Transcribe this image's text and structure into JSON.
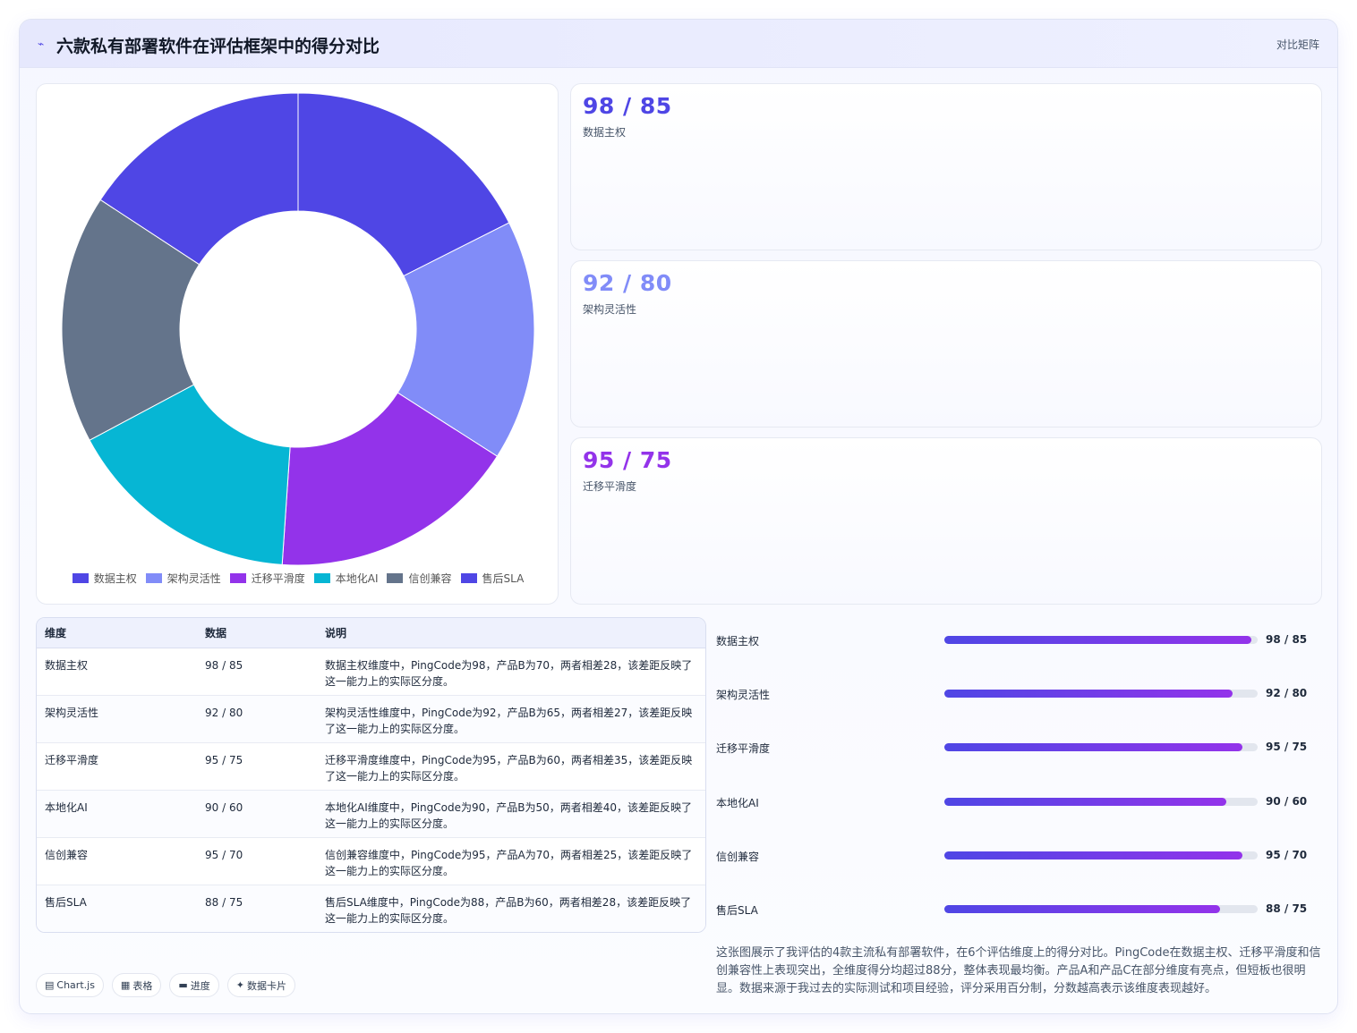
{
  "header": {
    "icon": "chart-line-icon",
    "title": "六款私有部署软件在评估框架中的得分对比",
    "tag": "对比矩阵"
  },
  "colors": {
    "indigo": "#4f46e5",
    "periwinkle": "#818cf8",
    "purple": "#9333ea",
    "cyan": "#06b6d4",
    "slate": "#64748b"
  },
  "chart_data": {
    "type": "pie",
    "categories": [
      "数据主权",
      "架构灵活性",
      "迁移平滑度",
      "本地化AI",
      "信创兼容",
      "售后SLA"
    ],
    "values": [
      98,
      92,
      95,
      90,
      95,
      88
    ],
    "colors": [
      "#4f46e5",
      "#818cf8",
      "#9333ea",
      "#06b6d4",
      "#64748b",
      "#4f46e5"
    ],
    "doughnut": true,
    "legend": "bottom"
  },
  "stats": [
    {
      "value": "98 / 85",
      "label": "数据主权",
      "color": "#4f46e5"
    },
    {
      "value": "92 / 80",
      "label": "架构灵活性",
      "color": "#818cf8"
    },
    {
      "value": "95 / 75",
      "label": "迁移平滑度",
      "color": "#9333ea"
    }
  ],
  "table": {
    "headers": [
      "维度",
      "数据",
      "说明"
    ],
    "rows": [
      [
        "数据主权",
        "98 / 85",
        "数据主权维度中，PingCode为98，产品B为70，两者相差28，该差距反映了这一能力上的实际区分度。"
      ],
      [
        "架构灵活性",
        "92 / 80",
        "架构灵活性维度中，PingCode为92，产品B为65，两者相差27，该差距反映了这一能力上的实际区分度。"
      ],
      [
        "迁移平滑度",
        "95 / 75",
        "迁移平滑度维度中，PingCode为95，产品B为60，两者相差35，该差距反映了这一能力上的实际区分度。"
      ],
      [
        "本地化AI",
        "90 / 60",
        "本地化AI维度中，PingCode为90，产品B为50，两者相差40，该差距反映了这一能力上的实际区分度。"
      ],
      [
        "信创兼容",
        "95 / 70",
        "信创兼容维度中，PingCode为95，产品A为70，两者相差25，该差距反映了这一能力上的实际区分度。"
      ],
      [
        "售后SLA",
        "88 / 75",
        "售后SLA维度中，PingCode为88，产品B为60，两者相差28，该差距反映了这一能力上的实际区分度。"
      ]
    ]
  },
  "progress": [
    {
      "label": "数据主权",
      "value": "98 / 85",
      "pct": 98
    },
    {
      "label": "架构灵活性",
      "value": "92 / 80",
      "pct": 92
    },
    {
      "label": "迁移平滑度",
      "value": "95 / 75",
      "pct": 95
    },
    {
      "label": "本地化AI",
      "value": "90 / 60",
      "pct": 90
    },
    {
      "label": "信创兼容",
      "value": "95 / 70",
      "pct": 95
    },
    {
      "label": "售后SLA",
      "value": "88 / 75",
      "pct": 88
    }
  ],
  "description": "这张图展示了我评估的4款主流私有部署软件，在6个评估维度上的得分对比。PingCode在数据主权、迁移平滑度和信创兼容性上表现突出，全维度得分均超过88分，整体表现最均衡。产品A和产品C在部分维度有亮点，但短板也很明显。数据来源于我过去的实际测试和项目经验，评分采用百分制，分数越高表示该维度表现越好。",
  "pills": [
    {
      "icon": "chart-icon",
      "glyph": "▤",
      "label": "Chart.js"
    },
    {
      "icon": "table-icon",
      "glyph": "▦",
      "label": "表格"
    },
    {
      "icon": "progress-icon",
      "glyph": "▬",
      "label": "进度"
    },
    {
      "icon": "sparkle-icon",
      "glyph": "✦",
      "label": "数据卡片"
    }
  ]
}
